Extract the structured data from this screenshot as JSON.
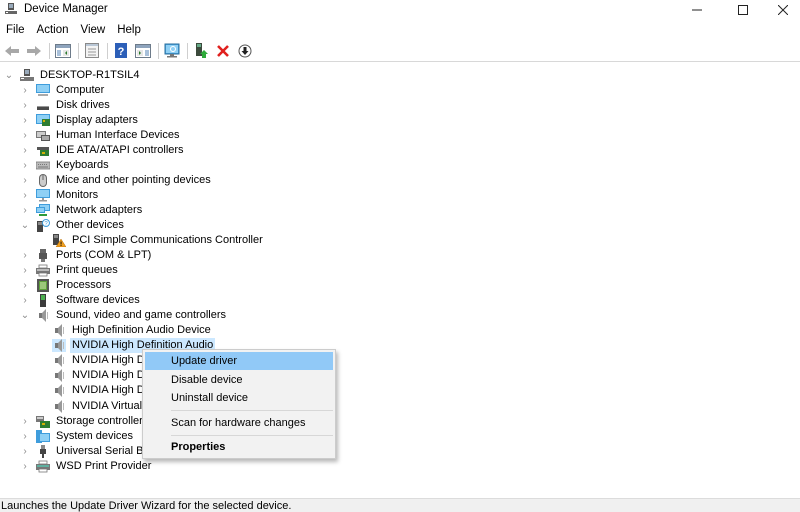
{
  "window": {
    "title": "Device Manager",
    "controls": {
      "minimize": "minimize",
      "maximize": "maximize",
      "close": "close"
    }
  },
  "menubar": {
    "items": [
      "File",
      "Action",
      "View",
      "Help"
    ]
  },
  "toolbar": {
    "buttons": [
      {
        "icon": "back-arrow-icon",
        "label": "Back"
      },
      {
        "icon": "forward-arrow-icon",
        "label": "Forward"
      },
      {
        "icon": "show-hide-console-tree-icon",
        "label": "Show/Hide Console Tree"
      },
      {
        "icon": "properties-icon",
        "label": "Properties"
      },
      {
        "icon": "help-icon",
        "label": "Help"
      },
      {
        "icon": "show-hide-action-pane-icon",
        "label": "Show/Hide Action Pane"
      },
      {
        "icon": "scan-hardware-icon",
        "label": "Scan for hardware changes"
      },
      {
        "icon": "update-driver-icon",
        "label": "Update driver"
      },
      {
        "icon": "uninstall-device-icon",
        "label": "Uninstall device"
      },
      {
        "icon": "disable-device-icon",
        "label": "Disable device"
      }
    ]
  },
  "tree": {
    "root": "DESKTOP-R1TSIL4",
    "nodes": [
      {
        "label": "Computer",
        "icon": "computer-icon",
        "expanded": false
      },
      {
        "label": "Disk drives",
        "icon": "disk-drive-icon",
        "expanded": false
      },
      {
        "label": "Display adapters",
        "icon": "display-adapter-icon",
        "expanded": false
      },
      {
        "label": "Human Interface Devices",
        "icon": "hid-icon",
        "expanded": false
      },
      {
        "label": "IDE ATA/ATAPI controllers",
        "icon": "ide-controller-icon",
        "expanded": false
      },
      {
        "label": "Keyboards",
        "icon": "keyboard-icon",
        "expanded": false
      },
      {
        "label": "Mice and other pointing devices",
        "icon": "mouse-icon",
        "expanded": false
      },
      {
        "label": "Monitors",
        "icon": "monitor-icon",
        "expanded": false
      },
      {
        "label": "Network adapters",
        "icon": "network-adapter-icon",
        "expanded": false
      },
      {
        "label": "Other devices",
        "icon": "other-devices-icon",
        "expanded": true,
        "children": [
          {
            "label": "PCI Simple Communications Controller",
            "icon": "warning-device-icon"
          }
        ]
      },
      {
        "label": "Ports (COM & LPT)",
        "icon": "port-icon",
        "expanded": false
      },
      {
        "label": "Print queues",
        "icon": "printer-icon",
        "expanded": false
      },
      {
        "label": "Processors",
        "icon": "processor-icon",
        "expanded": false
      },
      {
        "label": "Software devices",
        "icon": "software-device-icon",
        "expanded": false
      },
      {
        "label": "Sound, video and game controllers",
        "icon": "speaker-icon",
        "expanded": true,
        "children": [
          {
            "label": "High Definition Audio Device",
            "icon": "speaker-icon"
          },
          {
            "label": "NVIDIA High Definition Audio",
            "icon": "speaker-icon",
            "selected": true
          },
          {
            "label": "NVIDIA High Definition Audio",
            "icon": "speaker-icon"
          },
          {
            "label": "NVIDIA High Definition Audio",
            "icon": "speaker-icon"
          },
          {
            "label": "NVIDIA High Definition Audio",
            "icon": "speaker-icon"
          },
          {
            "label": "NVIDIA Virtual Audio Device",
            "icon": "speaker-icon"
          }
        ]
      },
      {
        "label": "Storage controllers",
        "icon": "storage-controller-icon",
        "expanded": false
      },
      {
        "label": "System devices",
        "icon": "system-devices-icon",
        "expanded": false
      },
      {
        "label": "Universal Serial Bus controllers",
        "icon": "usb-icon",
        "expanded": false
      },
      {
        "label": "WSD Print Provider",
        "icon": "printer-icon",
        "expanded": false
      }
    ]
  },
  "context_menu": {
    "items": [
      {
        "label": "Update driver",
        "highlighted": true
      },
      {
        "label": "Disable device"
      },
      {
        "label": "Uninstall device"
      },
      {
        "separator": true
      },
      {
        "label": "Scan for hardware changes"
      },
      {
        "separator": true
      },
      {
        "label": "Properties",
        "bold": true
      }
    ]
  },
  "statusbar": {
    "text": "Launches the Update Driver Wizard for the selected device."
  },
  "colors": {
    "selection": "#cce8ff",
    "menu_highlight": "#91c9f7",
    "menu_background": "#f2f2f2"
  }
}
